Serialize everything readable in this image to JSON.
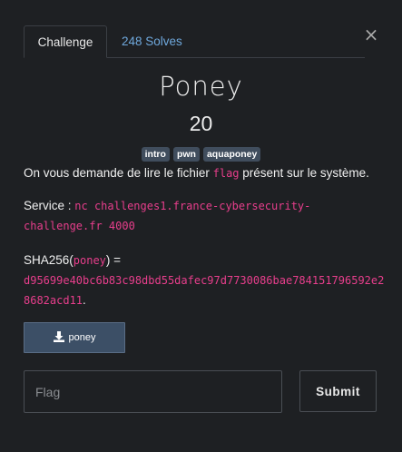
{
  "tabs": {
    "challenge": "Challenge",
    "solves": "248 Solves"
  },
  "close_glyph": "×",
  "challenge": {
    "name": "Poney",
    "points": "20",
    "tags": [
      "intro",
      "pwn",
      "aquaponey"
    ]
  },
  "description": {
    "text_before": "On vous demande de lire le fichier ",
    "code": "flag",
    "text_after": " présent sur le système."
  },
  "service": {
    "label": "Service : ",
    "command": "nc challenges1.france-cybersecurity-challenge.fr 4000"
  },
  "hash": {
    "label_prefix": "SHA256(",
    "file": "poney",
    "label_suffix": ") =",
    "value": "d95699e40bc6b83c98dbd55dafec97d7730086bae784151796592e28682acd11",
    "trailing": "."
  },
  "download": {
    "label": "poney",
    "icon": "download-icon"
  },
  "flag_input": {
    "value": "",
    "placeholder": "Flag"
  },
  "submit": {
    "label": "Submit"
  },
  "colors": {
    "background": "#1e2023",
    "link": "#6fa8dc",
    "code": "#e83e8c",
    "tag_bg": "#404d5d",
    "button_bg": "#3c4f66"
  }
}
